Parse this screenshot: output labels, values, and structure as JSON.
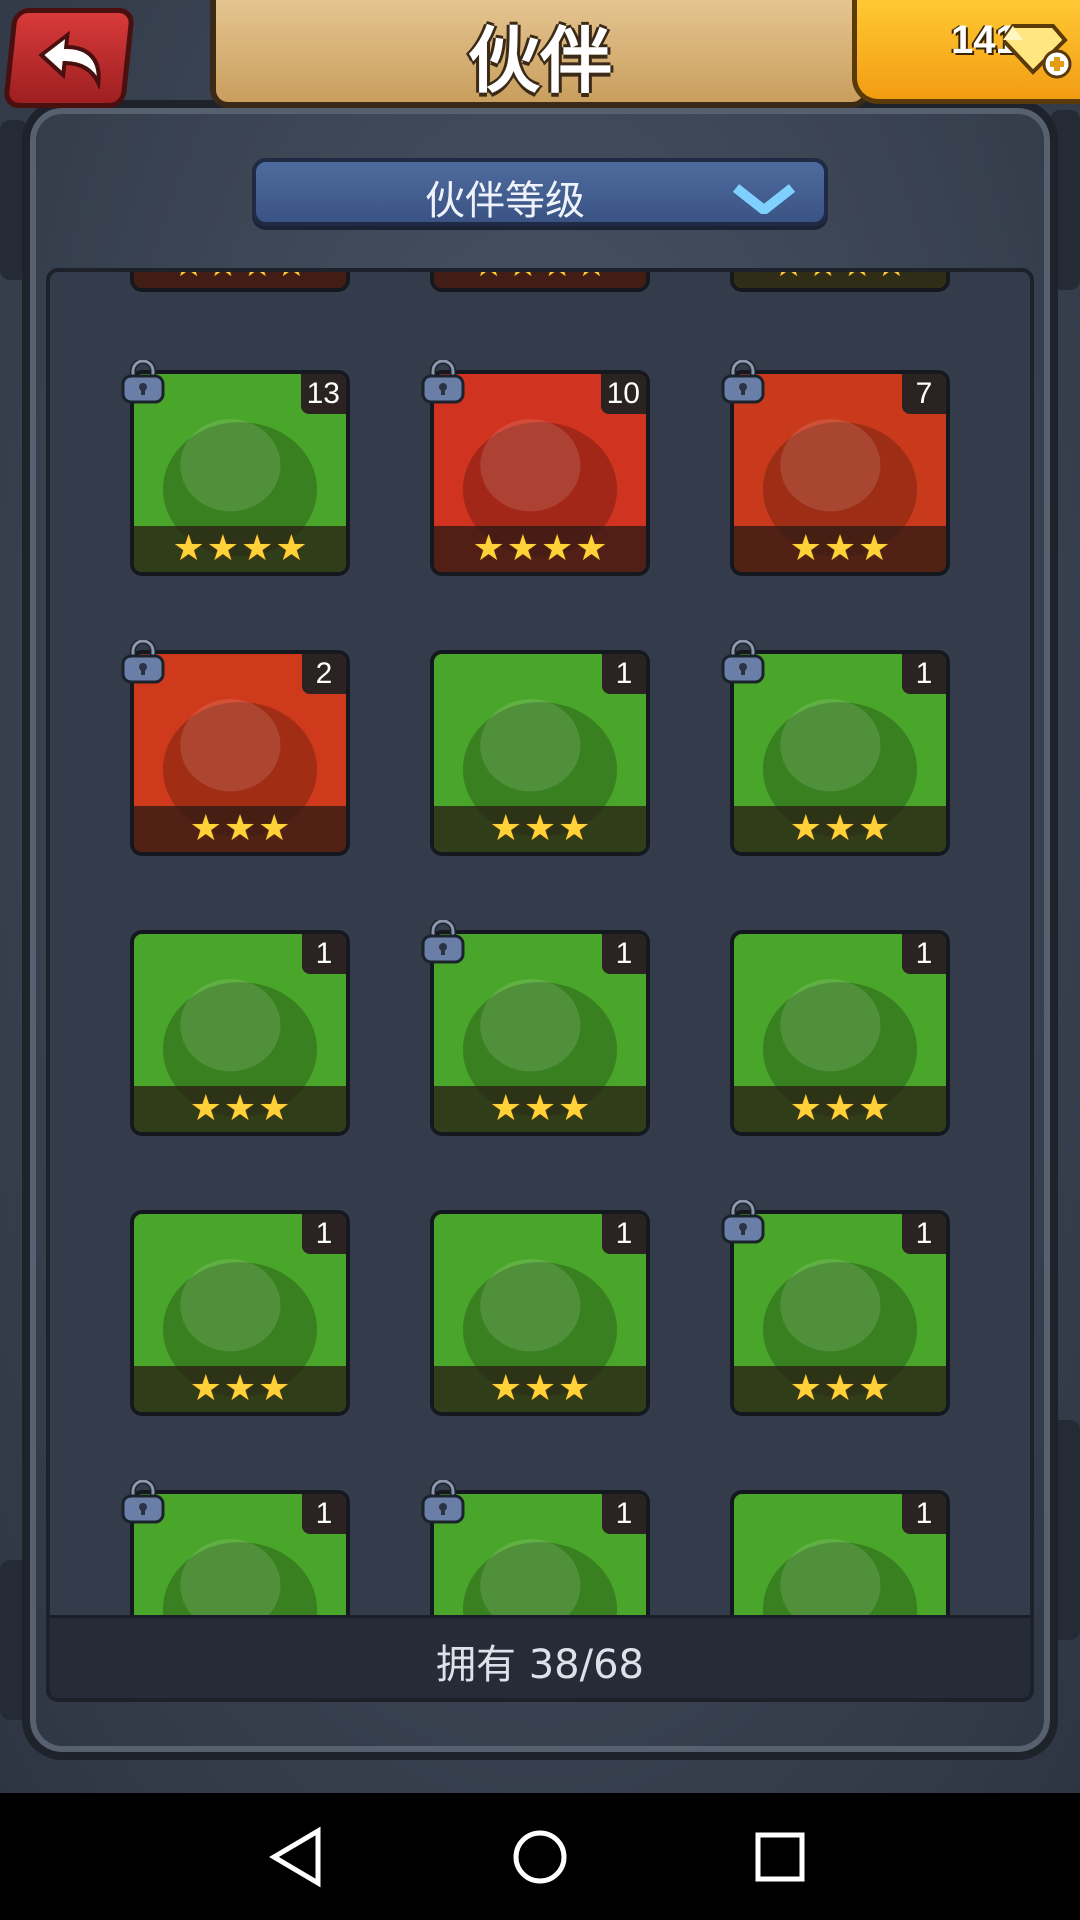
{
  "header": {
    "title": "伙伴",
    "gems": "141"
  },
  "sort": {
    "label": "伙伴等级"
  },
  "cards": [
    {
      "name": "crocodile-green",
      "count": "13",
      "stars": 4,
      "locked": true,
      "bg": "#4aa62a",
      "col": 0,
      "row": 0
    },
    {
      "name": "crocodile-red",
      "count": "10",
      "stars": 4,
      "locked": true,
      "bg": "#d0331f",
      "col": 1,
      "row": 0
    },
    {
      "name": "boar",
      "count": "7",
      "stars": 3,
      "locked": true,
      "bg": "#c93a1c",
      "col": 2,
      "row": 0
    },
    {
      "name": "warrior-red-hair",
      "count": "2",
      "stars": 3,
      "locked": true,
      "bg": "#cf3a1c",
      "col": 0,
      "row": 1
    },
    {
      "name": "druid-green-1",
      "count": "1",
      "stars": 3,
      "locked": false,
      "bg": "#4aa62a",
      "col": 1,
      "row": 1
    },
    {
      "name": "druid-green-2",
      "count": "1",
      "stars": 3,
      "locked": true,
      "bg": "#4aa62a",
      "col": 2,
      "row": 1
    },
    {
      "name": "druid-green-3",
      "count": "1",
      "stars": 3,
      "locked": false,
      "bg": "#4aa62a",
      "col": 0,
      "row": 2
    },
    {
      "name": "ogre",
      "count": "1",
      "stars": 3,
      "locked": true,
      "bg": "#4aa62a",
      "col": 1,
      "row": 2
    },
    {
      "name": "blonde-1",
      "count": "1",
      "stars": 3,
      "locked": false,
      "bg": "#4aa62a",
      "col": 2,
      "row": 2
    },
    {
      "name": "blonde-2",
      "count": "1",
      "stars": 3,
      "locked": false,
      "bg": "#4aa62a",
      "col": 0,
      "row": 3
    },
    {
      "name": "blonde-3",
      "count": "1",
      "stars": 3,
      "locked": false,
      "bg": "#4aa62a",
      "col": 1,
      "row": 3
    },
    {
      "name": "blonde-4",
      "count": "1",
      "stars": 3,
      "locked": true,
      "bg": "#4aa62a",
      "col": 2,
      "row": 3
    },
    {
      "name": "wolf",
      "count": "1",
      "stars": 3,
      "locked": true,
      "bg": "#4aa62a",
      "col": 0,
      "row": 4
    },
    {
      "name": "orc-1",
      "count": "1",
      "stars": 3,
      "locked": true,
      "bg": "#4aa62a",
      "col": 1,
      "row": 4
    },
    {
      "name": "orc-2",
      "count": "1",
      "stars": 3,
      "locked": false,
      "bg": "#4aa62a",
      "col": 2,
      "row": 4
    }
  ],
  "top_partial_cards": [
    {
      "stars": 4,
      "bg": "#8a2a1a"
    },
    {
      "stars": 4,
      "bg": "#8a2a1a"
    },
    {
      "stars": 4,
      "bg": "#4a6a20"
    }
  ],
  "footer": {
    "owned": "拥有 38/68"
  },
  "colors": {
    "accent": "#ffd23a",
    "panel": "#343c4b"
  }
}
